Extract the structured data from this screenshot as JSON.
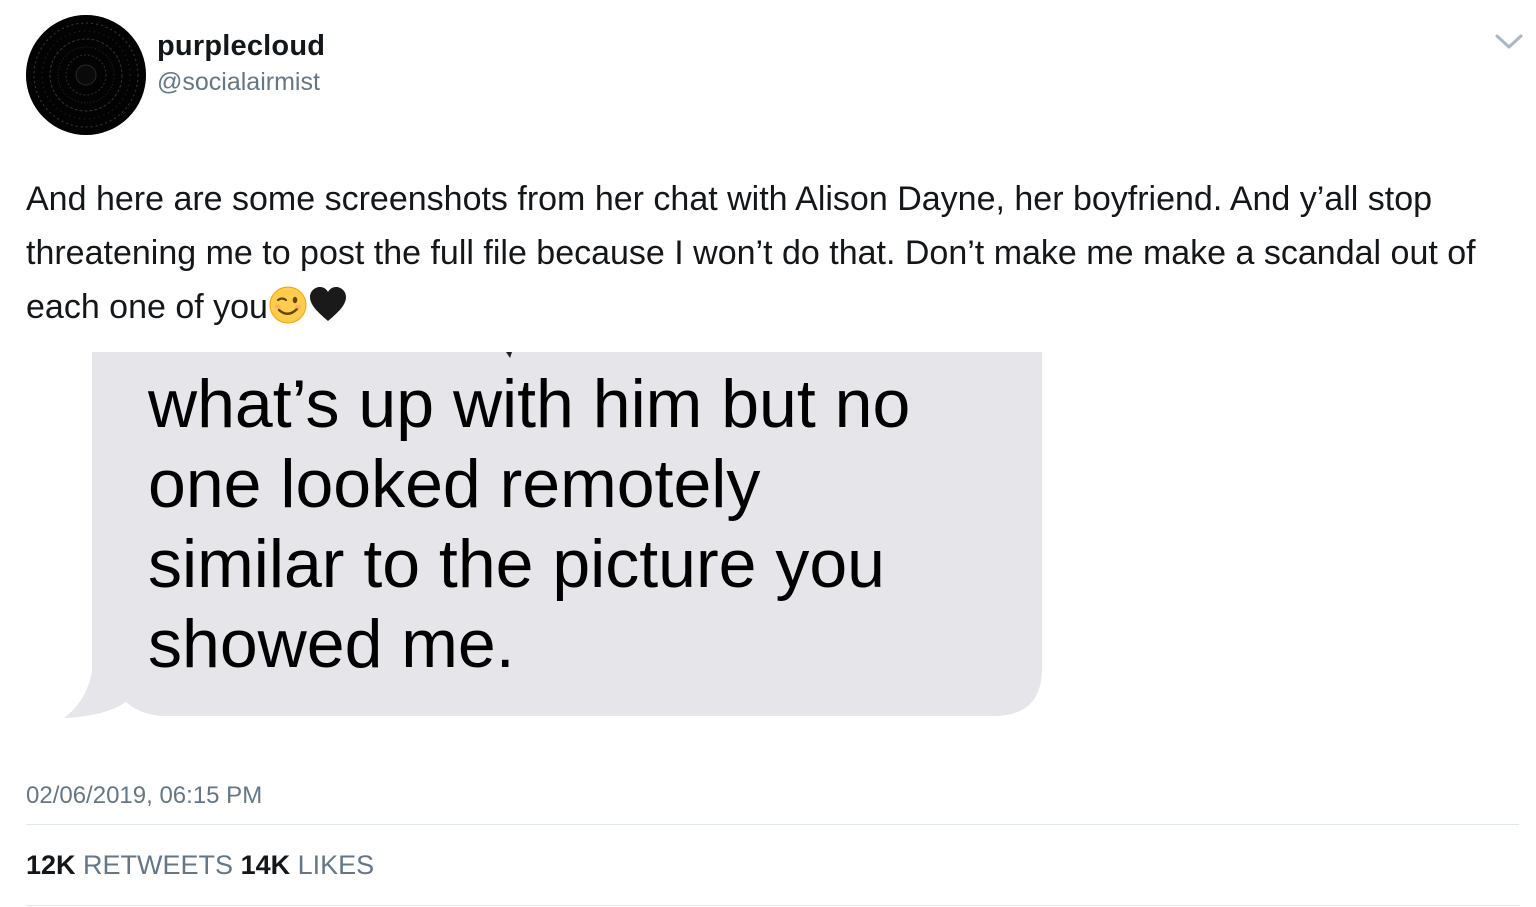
{
  "author": {
    "display_name": "purplecloud",
    "handle": "@socialairmist",
    "avatar_icon": "dark-circular-avatar"
  },
  "menu": {
    "caret_icon": "chevron-down-icon"
  },
  "tweet": {
    "text": "And here are some screenshots from her chat with Alison Dayne, her boyfriend. And y’all stop threatening me to post the full file because I won’t do that. Don’t make me make a scandal out of each one of you",
    "emojis": [
      "winking-face-icon",
      "black-heart-icon"
    ]
  },
  "media": {
    "bubble_color": "#e5e5ea",
    "message_lines": [
      "what’s up with him but no",
      "one looked remotely",
      "similar to the picture you",
      "showed me."
    ]
  },
  "meta": {
    "timestamp": "02/06/2019, 06:15 PM"
  },
  "stats": {
    "retweets_count": "12K",
    "retweets_label": "RETWEETS",
    "likes_count": "14K",
    "likes_label": "LIKES"
  },
  "colors": {
    "text_primary": "#14171a",
    "text_secondary": "#657786",
    "divider": "#e1e8ed"
  }
}
